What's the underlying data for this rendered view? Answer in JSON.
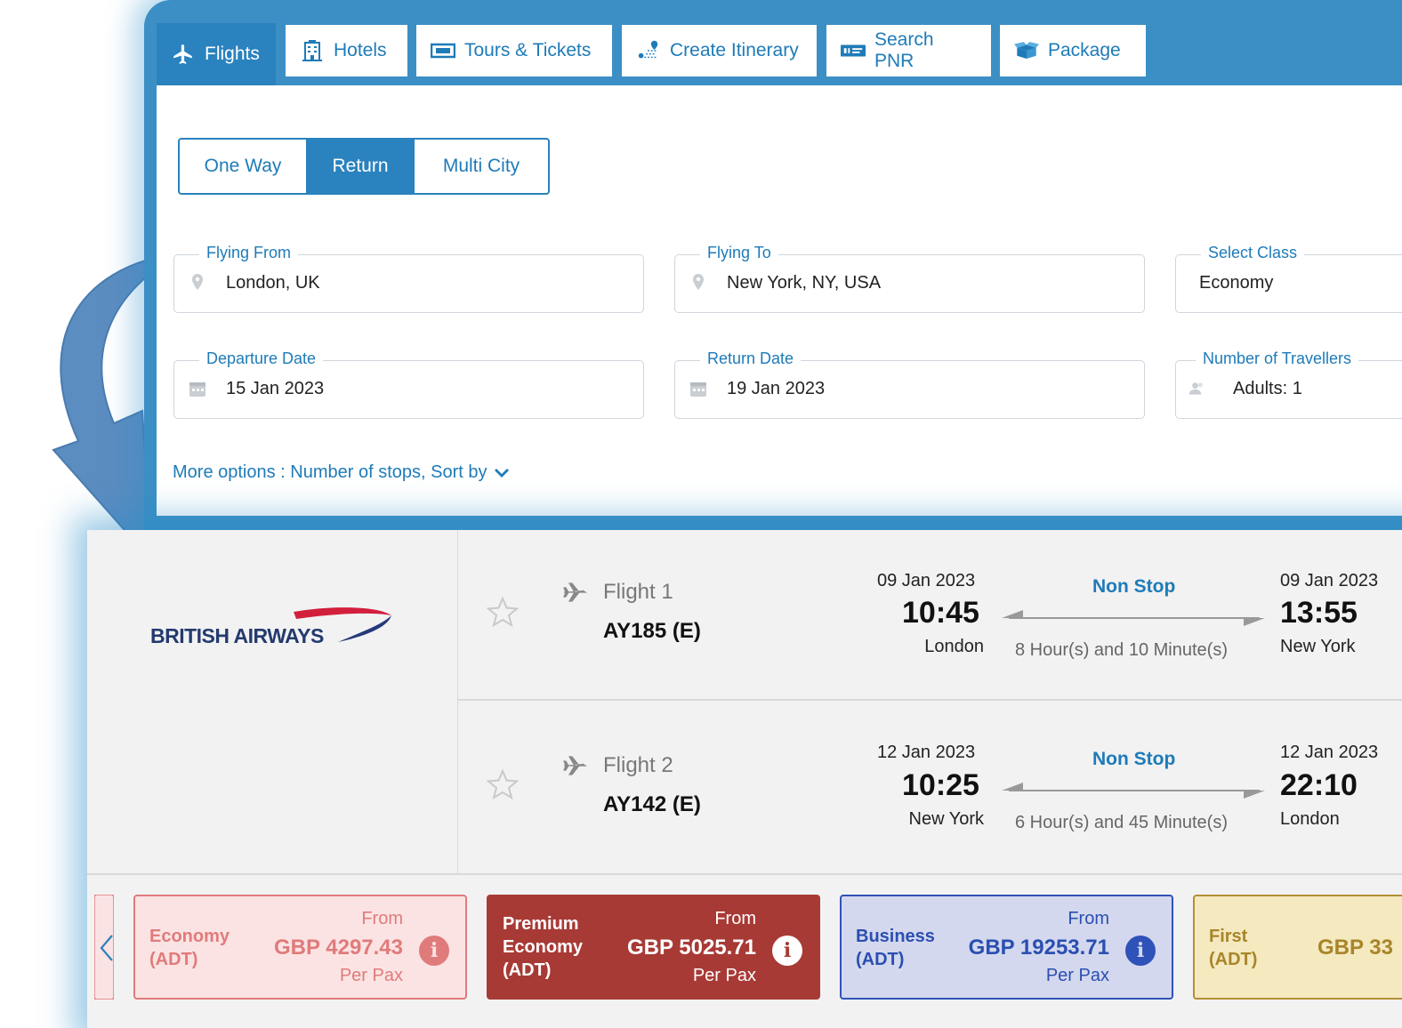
{
  "tabs": [
    {
      "label": "Flights",
      "icon": "airplane-icon",
      "active": true
    },
    {
      "label": "Hotels",
      "icon": "hotel-building-icon"
    },
    {
      "label": "Tours & Tickets",
      "icon": "ticket-icon"
    },
    {
      "label": "Create Itinerary",
      "icon": "route-icon"
    },
    {
      "label": "Search PNR",
      "icon": "pnr-ticket-icon"
    },
    {
      "label": "Package",
      "icon": "package-box-icon"
    }
  ],
  "trip_type": {
    "options": [
      "One Way",
      "Return",
      "Multi City"
    ],
    "selected": "Return"
  },
  "search": {
    "from": {
      "label": "Flying From",
      "value": "London, UK"
    },
    "to": {
      "label": "Flying To",
      "value": "New York, NY, USA"
    },
    "class": {
      "label": "Select Class",
      "value": "Economy"
    },
    "departure": {
      "label": "Departure Date",
      "value": "15 Jan 2023"
    },
    "return": {
      "label": "Return Date",
      "value": "19 Jan 2023"
    },
    "travellers": {
      "label": "Number of Travellers",
      "value": "Adults: 1"
    }
  },
  "more_options": "More options : Number of stops, Sort by",
  "airline": {
    "name": "BRITISH AIRWAYS"
  },
  "flights": [
    {
      "label": "Flight 1",
      "code": "AY185 (E)",
      "dep_date": "09 Jan 2023",
      "dep_time": "10:45",
      "dep_city": "London",
      "stops": "Non Stop",
      "duration": "8 Hour(s) and 10 Minute(s)",
      "arr_date": "09 Jan 2023",
      "arr_time": "13:55",
      "arr_city": "New York"
    },
    {
      "label": "Flight 2",
      "code": "AY142 (E)",
      "dep_date": "12 Jan 2023",
      "dep_time": "10:25",
      "dep_city": "New York",
      "stops": "Non Stop",
      "duration": "6 Hour(s) and 45 Minute(s)",
      "arr_date": "12 Jan 2023",
      "arr_time": "22:10",
      "arr_city": "London"
    }
  ],
  "fares": [
    {
      "cls1": "Economy",
      "cls2": "(ADT)",
      "from": "From",
      "price": "GBP 4297.43",
      "pp": "Per Pax",
      "bg": "#fbe3e3",
      "border": "#e07b7b",
      "color": "#e07b7b"
    },
    {
      "cls1": "Premium",
      "cls1b": "Economy",
      "cls2": "(ADT)",
      "from": "From",
      "price": "GBP 5025.71",
      "pp": "Per Pax",
      "bg": "#a83a36",
      "border": "#a83a36",
      "color": "#ffffff"
    },
    {
      "cls1": "Business",
      "cls2": "(ADT)",
      "from": "From",
      "price": "GBP 19253.71",
      "pp": "Per Pax",
      "bg": "#d4d8ef",
      "border": "#2f52b9",
      "color": "#2a4fb0"
    },
    {
      "cls1": "First",
      "cls2": "(ADT)",
      "price": "GBP 33",
      "bg": "#f4e9bf",
      "border": "#b38f34",
      "color": "#a8852a"
    }
  ]
}
